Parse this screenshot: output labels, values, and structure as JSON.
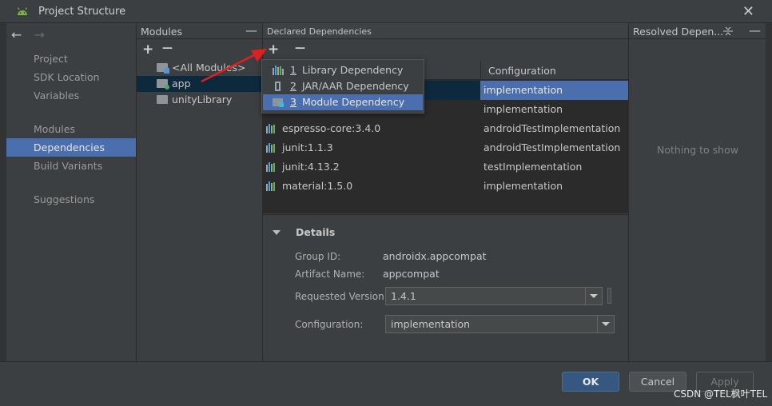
{
  "window": {
    "title": "Project Structure",
    "close_glyph": "✕"
  },
  "nav": {
    "back_glyph": "←",
    "forward_glyph": "→",
    "items": [
      {
        "label": "Project"
      },
      {
        "label": "SDK Location"
      },
      {
        "label": "Variables"
      },
      {
        "label": "Modules"
      },
      {
        "label": "Dependencies",
        "selected": true
      },
      {
        "label": "Build Variants"
      },
      {
        "label": "Suggestions"
      }
    ]
  },
  "modules": {
    "header": "Modules",
    "minus_glyph": "—",
    "add_glyph": "+",
    "remove_glyph": "—",
    "items": [
      {
        "label": "<All Modules>",
        "icon": "all-modules-icon"
      },
      {
        "label": "app",
        "icon": "module-app-icon",
        "selected": true
      },
      {
        "label": "unityLibrary",
        "icon": "module-icon"
      }
    ]
  },
  "declared": {
    "header": "Declared Dependencies",
    "add_glyph": "+",
    "remove_glyph": "—",
    "column_configuration": "Configuration",
    "rows": [
      {
        "name": "",
        "configuration": "implementation",
        "selected": true
      },
      {
        "name": "",
        "configuration": "implementation"
      },
      {
        "name": "espresso-core:3.4.0",
        "configuration": "androidTestImplementation"
      },
      {
        "name": "junit:1.1.3",
        "configuration": "androidTestImplementation"
      },
      {
        "name": "junit:4.13.2",
        "configuration": "testImplementation"
      },
      {
        "name": "material:1.5.0",
        "configuration": "implementation"
      }
    ]
  },
  "popup_menu": {
    "items": [
      {
        "num": "1",
        "label": "Library Dependency",
        "icon": "library-icon"
      },
      {
        "num": "2",
        "label": "JAR/AAR Dependency",
        "icon": "jar-icon"
      },
      {
        "num": "3",
        "label": "Module Dependency",
        "icon": "module-icon",
        "selected": true
      }
    ]
  },
  "details": {
    "header": "Details",
    "group_id_label": "Group ID:",
    "group_id_value": "androidx.appcompat",
    "artifact_label": "Artifact Name:",
    "artifact_value": "appcompat",
    "version_label": "Requested Version:",
    "version_value": "1.4.1",
    "config_label": "Configuration:",
    "config_value": "implementation"
  },
  "resolved": {
    "header": "Resolved Depen...",
    "empty_text": "Nothing to show",
    "minus_glyph": "—"
  },
  "footer": {
    "ok_label": "OK",
    "cancel_label": "Cancel",
    "apply_label": "Apply",
    "watermark": "CSDN @TEL枫叶TEL"
  },
  "colors": {
    "selection": "#4b6eaf",
    "annotation_arrow": "#e02020"
  }
}
